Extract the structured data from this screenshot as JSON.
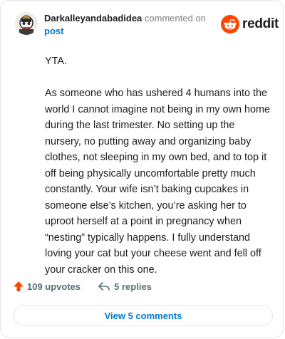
{
  "header": {
    "username": "Darkalleyandabadidea",
    "action": "commented on",
    "post_link": "post"
  },
  "logo": {
    "wordmark": "reddit",
    "icon": "reddit-snoo-icon",
    "brand_color": "#ff4500"
  },
  "comment": {
    "paragraphs": [
      "YTA.",
      "As someone who has ushered 4 humans into the world I cannot imagine not being in my own home during the last trimester. No setting up the nursery, no putting away and organizing baby clothes, not sleeping in my own bed, and to top it off being physically uncomfortable pretty much constantly. Your wife isn’t baking cupcakes in someone else’s kitchen, you’re asking her to uproot herself at a point in pregnancy when “nesting” typically happens. I fully understand loving your cat but your cheese went and fell off your cracker on this one."
    ]
  },
  "actions": {
    "upvotes_label": "109 upvotes",
    "upvote_icon": "upvote-arrow-icon",
    "upvote_color": "#ff4500",
    "replies_label": "5 replies",
    "reply_icon": "reply-arrow-icon"
  },
  "view_button": {
    "label": "View 5 comments"
  },
  "colors": {
    "link": "#0079d3",
    "text": "#1c1c1c",
    "muted": "#576f76",
    "border": "#e4e6e8"
  }
}
